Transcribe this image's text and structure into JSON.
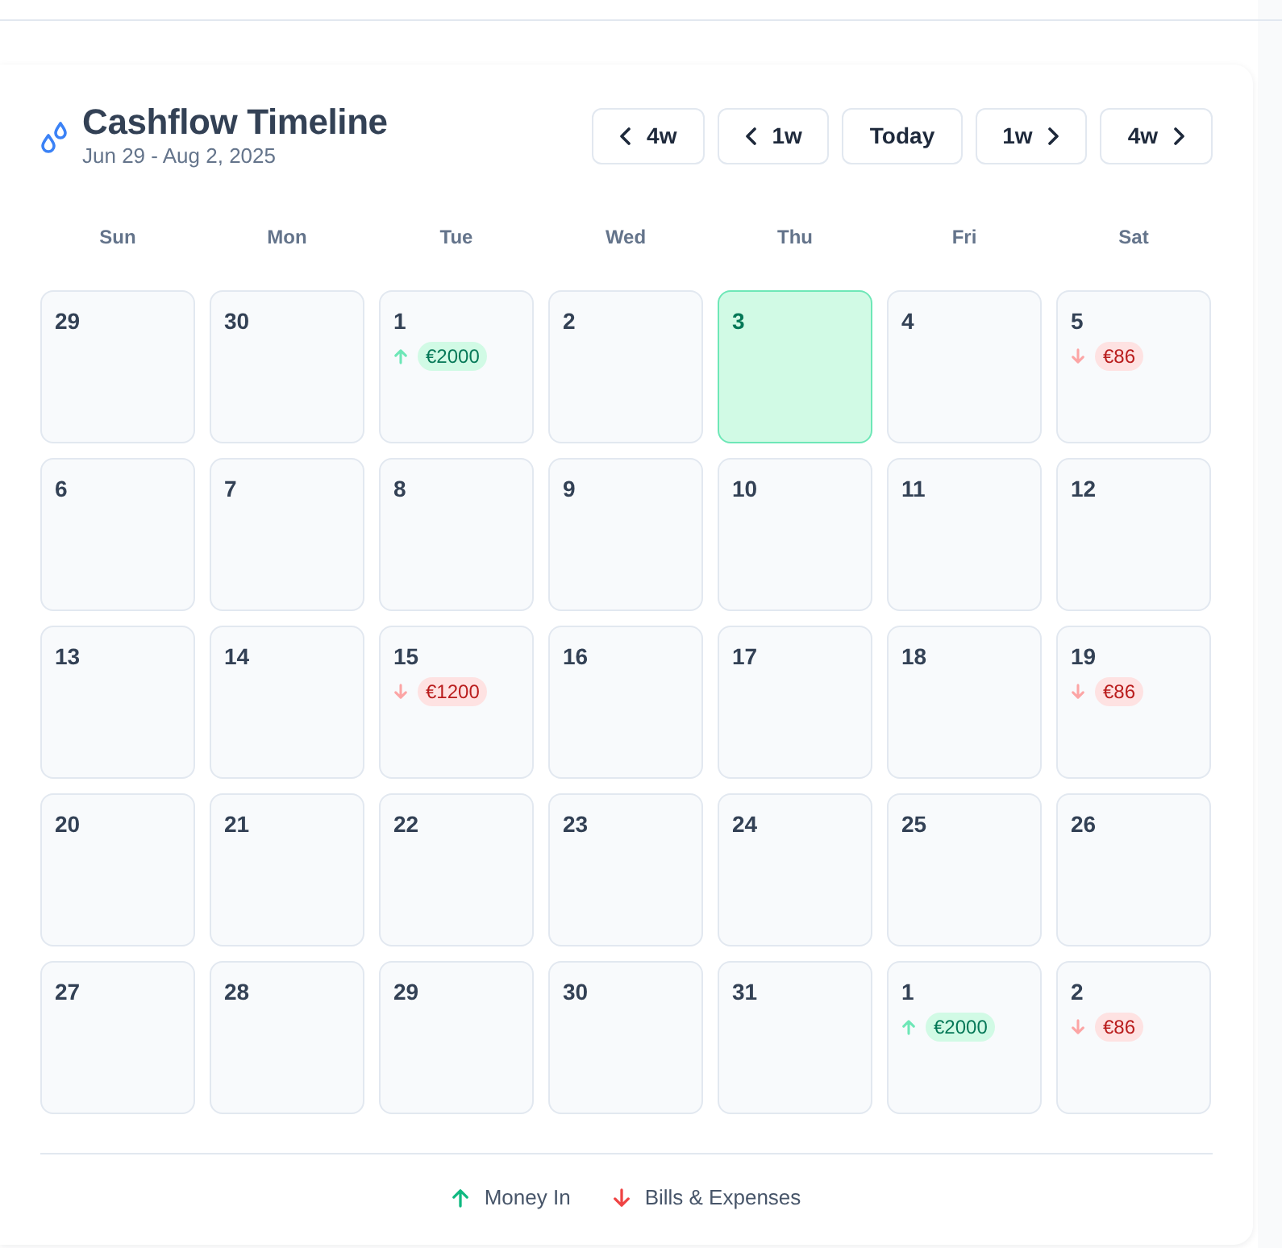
{
  "header": {
    "title": "Cashflow Timeline",
    "subtitle": "Jun 29 - Aug 2, 2025"
  },
  "nav_buttons": [
    {
      "label": "4w",
      "kind": "back"
    },
    {
      "label": "1w",
      "kind": "back"
    },
    {
      "label": "Today",
      "kind": "plain"
    },
    {
      "label": "1w",
      "kind": "forward"
    },
    {
      "label": "4w",
      "kind": "forward"
    }
  ],
  "weekdays": [
    "Sun",
    "Mon",
    "Tue",
    "Wed",
    "Thu",
    "Fri",
    "Sat"
  ],
  "weeks": [
    [
      {
        "day": "29",
        "today": false
      },
      {
        "day": "30",
        "today": false
      },
      {
        "day": "1",
        "today": false,
        "entries": [
          {
            "kind": "in",
            "amount": "€2000"
          }
        ]
      },
      {
        "day": "2",
        "today": false
      },
      {
        "day": "3",
        "today": true
      },
      {
        "day": "4",
        "today": false
      },
      {
        "day": "5",
        "today": false,
        "entries": [
          {
            "kind": "out",
            "amount": "€86"
          }
        ]
      }
    ],
    [
      {
        "day": "6",
        "today": false
      },
      {
        "day": "7",
        "today": false
      },
      {
        "day": "8",
        "today": false
      },
      {
        "day": "9",
        "today": false
      },
      {
        "day": "10",
        "today": false
      },
      {
        "day": "11",
        "today": false
      },
      {
        "day": "12",
        "today": false
      }
    ],
    [
      {
        "day": "13",
        "today": false
      },
      {
        "day": "14",
        "today": false
      },
      {
        "day": "15",
        "today": false,
        "entries": [
          {
            "kind": "out",
            "amount": "€1200"
          }
        ]
      },
      {
        "day": "16",
        "today": false
      },
      {
        "day": "17",
        "today": false
      },
      {
        "day": "18",
        "today": false
      },
      {
        "day": "19",
        "today": false,
        "entries": [
          {
            "kind": "out",
            "amount": "€86"
          }
        ]
      }
    ],
    [
      {
        "day": "20",
        "today": false
      },
      {
        "day": "21",
        "today": false
      },
      {
        "day": "22",
        "today": false
      },
      {
        "day": "23",
        "today": false
      },
      {
        "day": "24",
        "today": false
      },
      {
        "day": "25",
        "today": false
      },
      {
        "day": "26",
        "today": false
      }
    ],
    [
      {
        "day": "27",
        "today": false
      },
      {
        "day": "28",
        "today": false
      },
      {
        "day": "29",
        "today": false
      },
      {
        "day": "30",
        "today": false
      },
      {
        "day": "31",
        "today": false
      },
      {
        "day": "1",
        "today": false,
        "entries": [
          {
            "kind": "in",
            "amount": "€2000"
          }
        ]
      },
      {
        "day": "2",
        "today": false,
        "entries": [
          {
            "kind": "out",
            "amount": "€86"
          }
        ]
      }
    ]
  ],
  "legend": [
    {
      "kind": "in",
      "label": "Money In"
    },
    {
      "kind": "out",
      "label": "Bills & Expenses"
    }
  ]
}
